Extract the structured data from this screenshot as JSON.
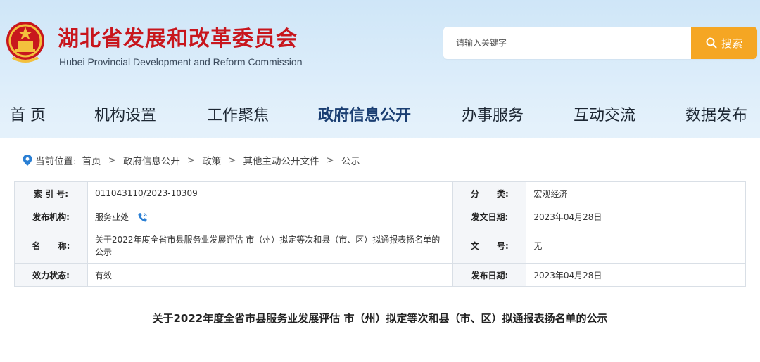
{
  "header": {
    "site_title": "湖北省发展和改革委员会",
    "site_subtitle": "Hubei Provincial Development and Reform Commission",
    "emblem_icon": "national-emblem-icon",
    "title_color": "#c8161d"
  },
  "search": {
    "placeholder": "请输入关键字",
    "button_label": "搜索",
    "button_color": "#f5a623"
  },
  "nav": {
    "items": [
      {
        "label": "首 页"
      },
      {
        "label": "机构设置"
      },
      {
        "label": "工作聚焦"
      },
      {
        "label": "政府信息公开",
        "active": true
      },
      {
        "label": "办事服务"
      },
      {
        "label": "互动交流"
      },
      {
        "label": "数据发布"
      }
    ]
  },
  "breadcrumb": {
    "prefix": "当前位置:",
    "items": [
      "首页",
      "政府信息公开",
      "政策",
      "其他主动公开文件",
      "公示"
    ],
    "separator": ">"
  },
  "meta": {
    "index_label": "索 引 号:",
    "index_value": "011043110/2023-10309",
    "category_label": "分      类:",
    "category_value": "宏观经济",
    "publisher_label": "发布机构:",
    "publisher_value": "服务业处",
    "issue_date_label": "发文日期:",
    "issue_date_value": "2023年04月28日",
    "name_label": "名      称:",
    "name_value": "关于2022年度全省市县服务业发展评估 市（州）拟定等次和县（市、区）拟通报表扬名单的公示",
    "doc_no_label": "文      号:",
    "doc_no_value": "无",
    "status_label": "效力状态:",
    "status_value": "有效",
    "publish_date_label": "发布日期:",
    "publish_date_value": "2023年04月28日"
  },
  "document": {
    "title": "关于2022年度全省市县服务业发展评估 市（州）拟定等次和县（市、区）拟通报表扬名单的公示"
  }
}
